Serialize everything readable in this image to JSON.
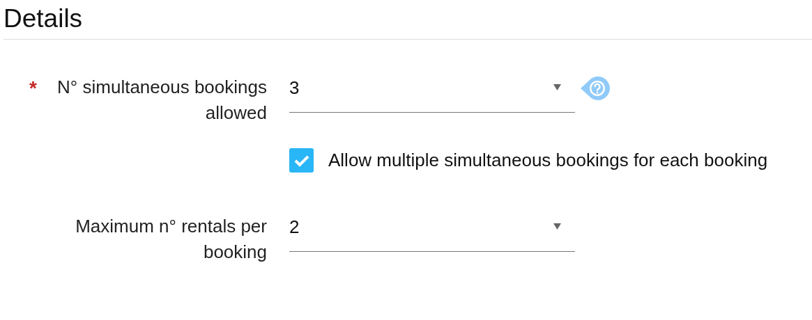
{
  "section": {
    "title": "Details"
  },
  "fields": [
    {
      "kind": "select",
      "required_mark": "*",
      "label": "N° simultaneous bookings allowed",
      "value": "3",
      "help": true
    },
    {
      "kind": "checkbox",
      "label": "Allow multiple simultaneous bookings for each booking",
      "checked": true
    },
    {
      "kind": "select",
      "label": "Maximum n° rentals per booking",
      "value": "2",
      "help": false
    }
  ]
}
